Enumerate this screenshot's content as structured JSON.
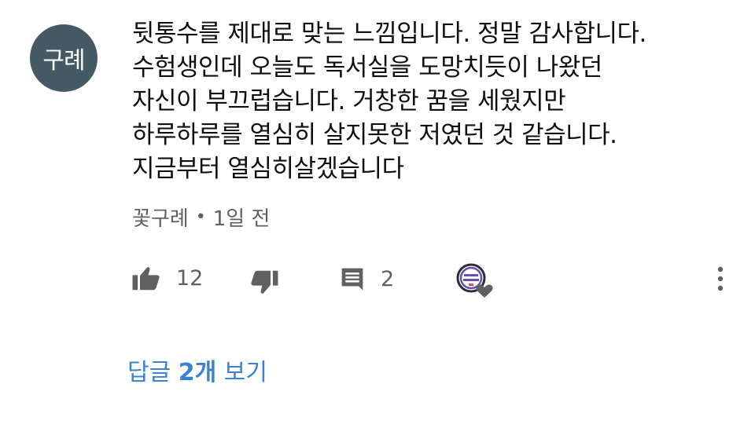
{
  "comment": {
    "avatar_text": "구례",
    "lines": [
      "뒷통수를 제대로 맞는 느낌입니다. 정말 감사합니다.",
      "수험생인데 오늘도 독서실을 도망치듯이 나왔던",
      "자신이 부끄럽습니다. 거창한 꿈을 세웠지만",
      "하루하루를 열심히 살지못한 저였던 것 같습니다.",
      "지금부터 열심히살겠습니다"
    ],
    "author": "꽃구례",
    "separator": "•",
    "time": "1일 전",
    "likes": "12",
    "reply_count": "2",
    "view_replies_prefix": "답글 ",
    "view_replies_count": "2개",
    "view_replies_suffix": " 보기"
  },
  "icons": {
    "like": "thumb-up-icon",
    "dislike": "thumb-down-icon",
    "reply": "comment-icon",
    "creator_heart": "creator-heart-icon",
    "more": "more-vert-icon"
  },
  "colors": {
    "avatar_bg": "#455a64",
    "link": "#3a83d3",
    "meta": "#606060",
    "heart": "#606060"
  }
}
